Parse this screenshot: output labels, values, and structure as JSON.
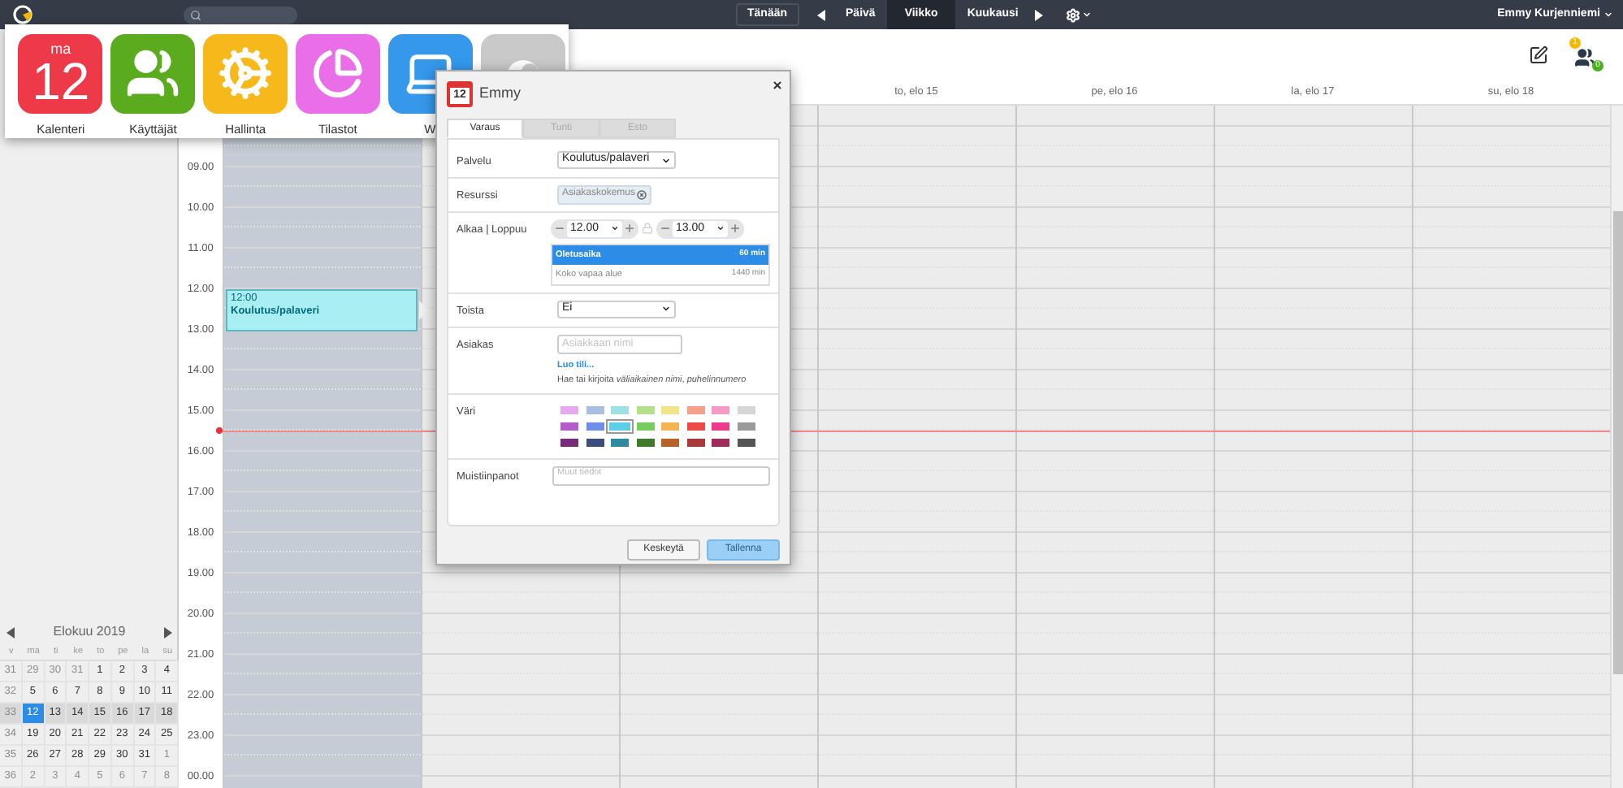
{
  "topbar": {
    "nav": {
      "today": "Tänään",
      "views": [
        {
          "label": "Päivä",
          "selected": false
        },
        {
          "label": "Viikko",
          "selected": true
        },
        {
          "label": "Kuukausi",
          "selected": false
        }
      ]
    },
    "user": "Emmy Kurjenniemi"
  },
  "launcher": [
    {
      "kind": "calendar",
      "label": "Kalenteri",
      "color": "#ee3a48",
      "weekday": "ma",
      "day": "12"
    },
    {
      "kind": "users",
      "label": "Käyttäjät",
      "color": "#5aab1e"
    },
    {
      "kind": "gears",
      "label": "Hallinta",
      "color": "#f7b81c"
    },
    {
      "kind": "stats",
      "label": "Tilastot",
      "color": "#e96ee8"
    },
    {
      "kind": "laptop",
      "label": "W",
      "color": "#3598ea"
    },
    {
      "kind": "other",
      "color": "#c9c9c9"
    }
  ],
  "badges": {
    "pending": "1",
    "online": "0"
  },
  "week": {
    "days": [
      {
        "today": true,
        "events": [
          {
            "time": "12:00",
            "title": "Koulutus/palaveri"
          }
        ]
      },
      {
        "today": false
      },
      {
        "today": false
      },
      {
        "label": "to, elo 15",
        "today": false
      },
      {
        "label": "pe, elo 16",
        "today": false
      },
      {
        "label": "la, elo 17",
        "today": false
      },
      {
        "label": "su, elo 18",
        "today": false
      }
    ],
    "times": [
      "09.00",
      "10.00",
      "11.00",
      "12.00",
      "13.00",
      "14.00",
      "15.00",
      "16.00",
      "17.00",
      "18.00",
      "19.00",
      "20.00",
      "21.00",
      "22.00",
      "23.00",
      "00.00"
    ]
  },
  "dialog": {
    "title": "Emmy",
    "icon_day": "12",
    "tabs": [
      {
        "label": "Varaus",
        "selected": true,
        "disabled": false
      },
      {
        "label": "Tunti",
        "selected": false,
        "disabled": true
      },
      {
        "label": "Esto",
        "selected": false,
        "disabled": true
      }
    ],
    "service": {
      "label": "Palvelu",
      "value": "Koulutus/palaveri"
    },
    "resource": {
      "label": "Resurssi",
      "tag": "Asiakaskokemus"
    },
    "time": {
      "label": "Alkaa | Loppuu",
      "start": "12.00",
      "end": "13.00",
      "durations": [
        {
          "label": "Oletusaika",
          "minutes": "60 min",
          "selected": true
        },
        {
          "label": "Koko vapaa alue",
          "minutes": "1440 min",
          "selected": false
        }
      ]
    },
    "repeat": {
      "label": "Toista",
      "value": "Ei"
    },
    "customer": {
      "label": "Asiakas",
      "placeholder": "Asiakkaan nimi",
      "link": "Luo tili...",
      "hint": "Hae tai kirjoita *väliaikainen nimi*, *puhelinnumero*"
    },
    "colors": {
      "label": "Väri",
      "swatches": [
        {
          "color": "#e8a8f0",
          "selected": false
        },
        {
          "color": "#a8bfe0",
          "selected": false
        },
        {
          "color": "#9ee0e6",
          "selected": false
        },
        {
          "color": "#b5e08a",
          "selected": false
        },
        {
          "color": "#f2e48a",
          "selected": false
        },
        {
          "color": "#f5a08a",
          "selected": false
        },
        {
          "color": "#f79ac8",
          "selected": false
        },
        {
          "color": "#d6d6d6",
          "selected": false
        },
        {
          "color": "#b45ccc",
          "selected": false
        },
        {
          "color": "#6f8ee8",
          "selected": false
        },
        {
          "color": "#5ccfe6",
          "selected": true
        },
        {
          "color": "#76cc5c",
          "selected": false
        },
        {
          "color": "#f5b454",
          "selected": false
        },
        {
          "color": "#ee4a4a",
          "selected": false
        },
        {
          "color": "#ee3a8a",
          "selected": false
        },
        {
          "color": "#9a9a9a",
          "selected": false
        },
        {
          "color": "#7a2a7a",
          "selected": false
        },
        {
          "color": "#3a4f7a",
          "selected": false
        },
        {
          "color": "#2e8aa0",
          "selected": false
        },
        {
          "color": "#3f7a2a",
          "selected": false
        },
        {
          "color": "#b8622a",
          "selected": false
        },
        {
          "color": "#a83a3a",
          "selected": false
        },
        {
          "color": "#a02a5a",
          "selected": false
        },
        {
          "color": "#555555",
          "selected": false
        }
      ]
    },
    "notes": {
      "label": "Muistiinpanot",
      "placeholder": "Muut tiedot"
    },
    "buttons": {
      "cancel": "Keskeytä",
      "save": "Tallenna"
    }
  },
  "mini_calendar": {
    "title": "Elokuu 2019",
    "weekdays": [
      "v",
      "ma",
      "ti",
      "ke",
      "to",
      "pe",
      "la",
      "su"
    ],
    "weeks": [
      {
        "number": "31",
        "current": false,
        "days": [
          {
            "label": "29",
            "outside": true,
            "selected": false
          },
          {
            "label": "30",
            "outside": true,
            "selected": false
          },
          {
            "label": "31",
            "outside": true,
            "selected": false
          },
          {
            "label": "1",
            "outside": false,
            "selected": false
          },
          {
            "label": "2",
            "outside": false,
            "selected": false
          },
          {
            "label": "3",
            "outside": false,
            "selected": false
          },
          {
            "label": "4",
            "outside": false,
            "selected": false
          }
        ]
      },
      {
        "number": "32",
        "current": false,
        "days": [
          {
            "label": "5",
            "outside": false,
            "selected": false
          },
          {
            "label": "6",
            "outside": false,
            "selected": false
          },
          {
            "label": "7",
            "outside": false,
            "selected": false
          },
          {
            "label": "8",
            "outside": false,
            "selected": false
          },
          {
            "label": "9",
            "outside": false,
            "selected": false
          },
          {
            "label": "10",
            "outside": false,
            "selected": false
          },
          {
            "label": "11",
            "outside": false,
            "selected": false
          }
        ]
      },
      {
        "number": "33",
        "current": true,
        "days": [
          {
            "label": "12",
            "outside": false,
            "selected": true
          },
          {
            "label": "13",
            "outside": false,
            "selected": false
          },
          {
            "label": "14",
            "outside": false,
            "selected": false
          },
          {
            "label": "15",
            "outside": false,
            "selected": false
          },
          {
            "label": "16",
            "outside": false,
            "selected": false
          },
          {
            "label": "17",
            "outside": false,
            "selected": false
          },
          {
            "label": "18",
            "outside": false,
            "selected": false
          }
        ]
      },
      {
        "number": "34",
        "current": false,
        "days": [
          {
            "label": "19",
            "outside": false,
            "selected": false
          },
          {
            "label": "20",
            "outside": false,
            "selected": false
          },
          {
            "label": "21",
            "outside": false,
            "selected": false
          },
          {
            "label": "22",
            "outside": false,
            "selected": false
          },
          {
            "label": "23",
            "outside": false,
            "selected": false
          },
          {
            "label": "24",
            "outside": false,
            "selected": false
          },
          {
            "label": "25",
            "outside": false,
            "selected": false
          }
        ]
      },
      {
        "number": "35",
        "current": false,
        "days": [
          {
            "label": "26",
            "outside": false,
            "selected": false
          },
          {
            "label": "27",
            "outside": false,
            "selected": false
          },
          {
            "label": "28",
            "outside": false,
            "selected": false
          },
          {
            "label": "29",
            "outside": false,
            "selected": false
          },
          {
            "label": "30",
            "outside": false,
            "selected": false
          },
          {
            "label": "31",
            "outside": false,
            "selected": false
          },
          {
            "label": "1",
            "outside": true,
            "selected": false
          }
        ]
      },
      {
        "number": "36",
        "current": false,
        "days": [
          {
            "label": "2",
            "outside": true,
            "selected": false
          },
          {
            "label": "3",
            "outside": true,
            "selected": false
          },
          {
            "label": "4",
            "outside": true,
            "selected": false
          },
          {
            "label": "5",
            "outside": true,
            "selected": false
          },
          {
            "label": "6",
            "outside": true,
            "selected": false
          },
          {
            "label": "7",
            "outside": true,
            "selected": false
          },
          {
            "label": "8",
            "outside": true,
            "selected": false
          }
        ]
      }
    ]
  }
}
